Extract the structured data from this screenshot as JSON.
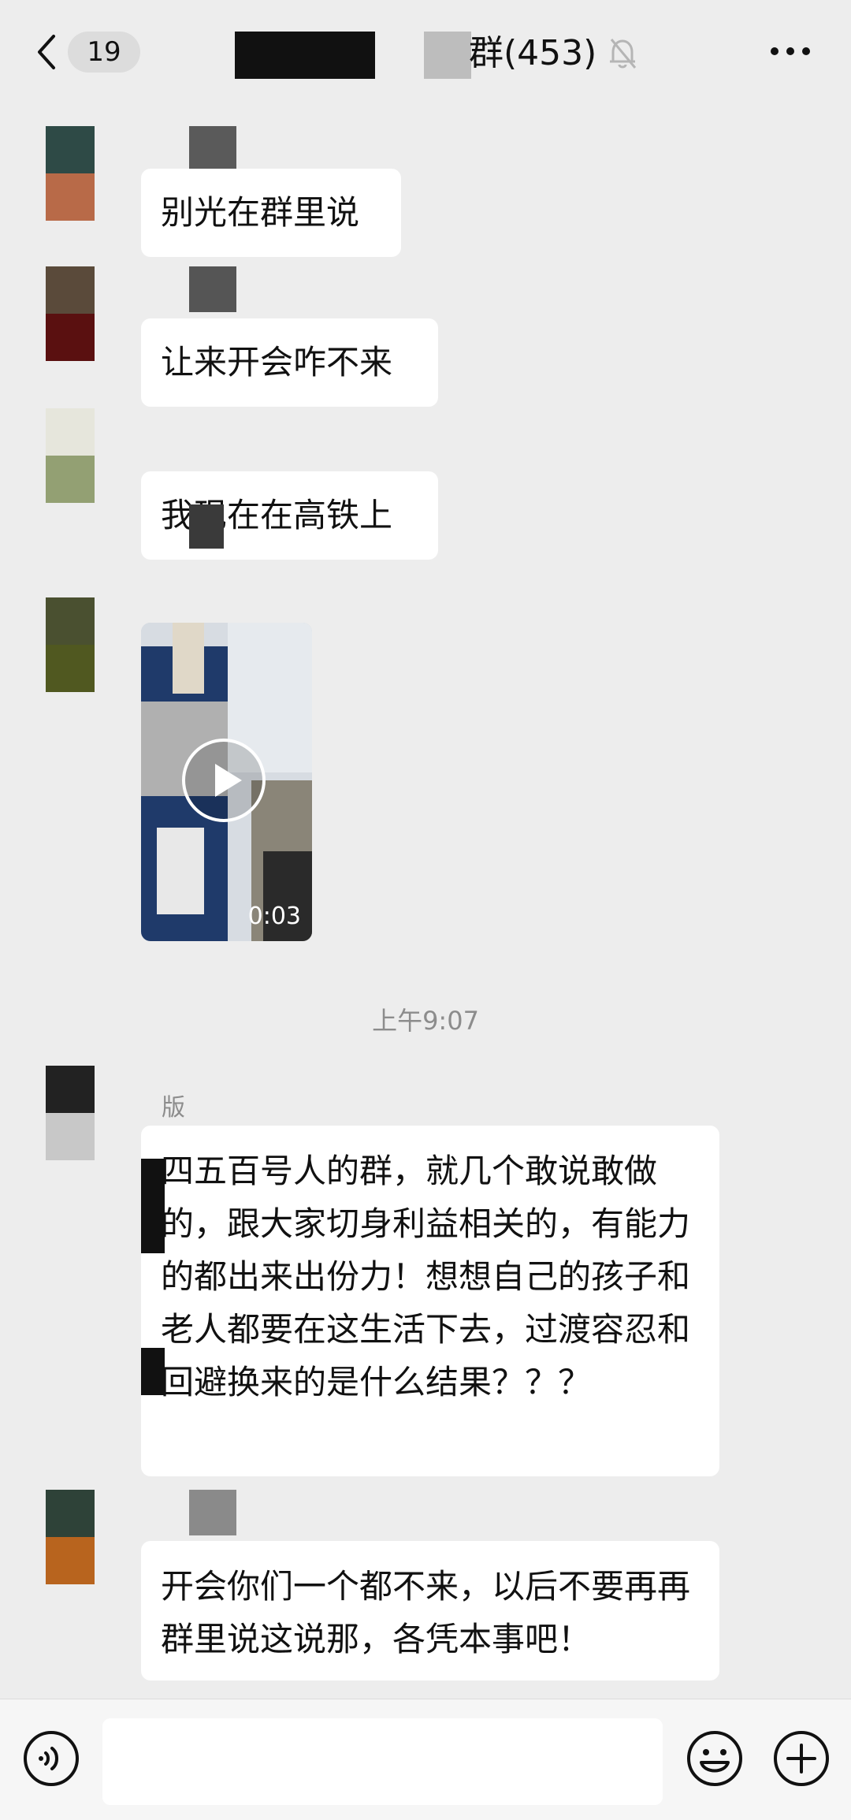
{
  "header": {
    "unread_badge": "19",
    "title_suffix": "群(453)"
  },
  "messages": [
    {
      "text": "别光在群里说"
    },
    {
      "text": "让来开会咋不来"
    },
    {
      "text": "我现在在高铁上"
    },
    {
      "video_duration": "0:03"
    },
    {
      "timestamp": "上午9:07"
    },
    {
      "sender_name": "版",
      "text": "四五百号人的群，就几个敢说敢做的，跟大家切身利益相关的，有能力的都出来出份力！想想自己的孩子和老人都要在这生活下去，过渡容忍和回避换来的是什么结果？？？"
    },
    {
      "text": "开会你们一个都不来，以后不要再再群里说这说那，各凭本事吧！"
    }
  ],
  "input_bar": {
    "placeholder": ""
  },
  "colors": {
    "background": "#ededed",
    "bubble": "#ffffff",
    "header_redaction": "#111111"
  }
}
